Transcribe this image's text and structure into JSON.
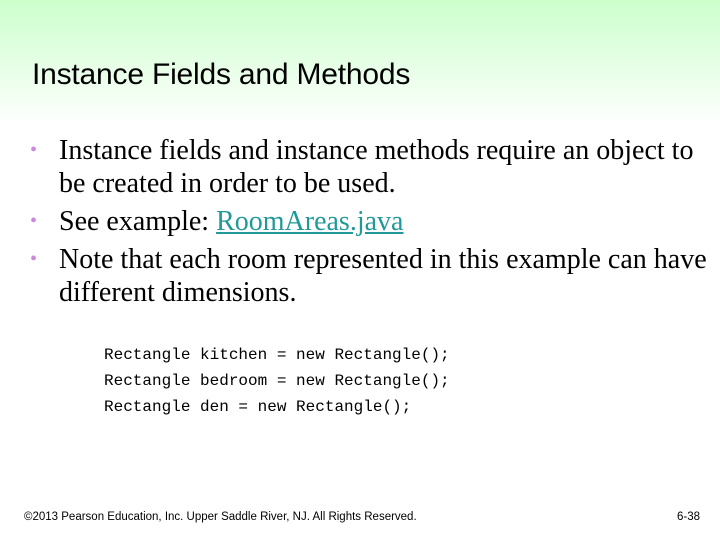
{
  "slide": {
    "title": "Instance Fields and Methods",
    "bullets": [
      {
        "text": "Instance fields and instance methods require an object to be created in order to be used."
      },
      {
        "prefix": "See example: ",
        "link": "RoomAreas.java"
      },
      {
        "text": "Note that each room represented in this example can have different dimensions."
      }
    ],
    "bullet_glyph": "•",
    "code_lines": [
      "Rectangle kitchen = new Rectangle();",
      "Rectangle bedroom = new Rectangle();",
      "Rectangle den = new Rectangle();"
    ],
    "footer": {
      "copyright": "©2013 Pearson Education, Inc. Upper Saddle River, NJ. All Rights Reserved.",
      "page_number": "6-38"
    }
  },
  "colors": {
    "header_gradient_top": "#ccffcc",
    "bullet": "#cc88dd",
    "link": "#229999"
  }
}
